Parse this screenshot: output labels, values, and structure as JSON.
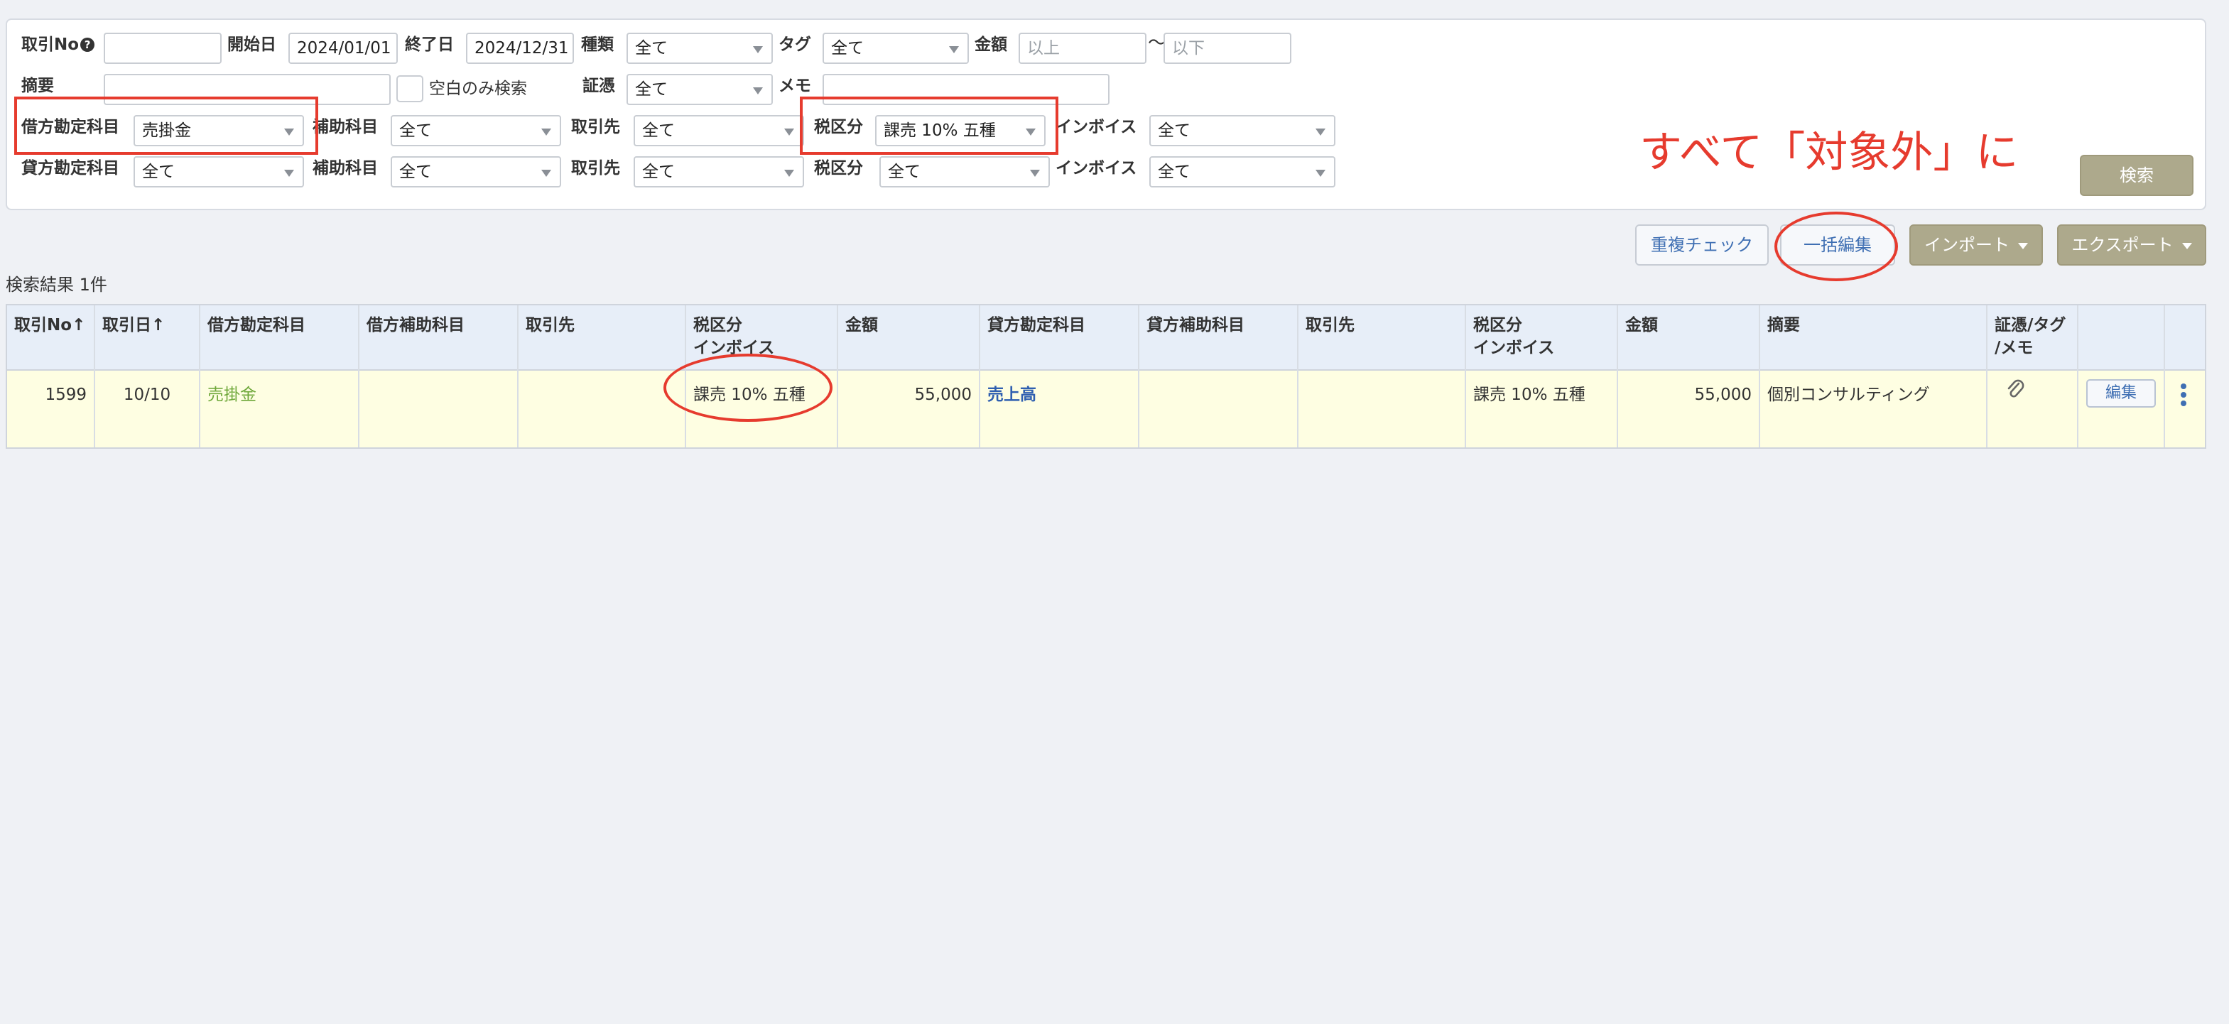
{
  "filters": {
    "row1": {
      "txn_no_label": "取引No",
      "help_icon": "?",
      "start_label": "開始日",
      "start_value": "2024/01/01",
      "end_label": "終了日",
      "end_value": "2024/12/31",
      "type_label": "種類",
      "type_value": "全て",
      "tag_label": "タグ",
      "tag_value": "全て",
      "amount_label": "金額",
      "amount_min_placeholder": "以上",
      "tilde": "〜",
      "amount_max_placeholder": "以下"
    },
    "row2": {
      "summary_label": "摘要",
      "blank_only_label": "空白のみ検索",
      "evidence_label": "証憑",
      "evidence_value": "全て",
      "memo_label": "メモ"
    },
    "row3": {
      "debit_account_label": "借方勘定科目",
      "debit_account_value": "売掛金",
      "sub_account_label": "補助科目",
      "sub_account_value": "全て",
      "partner_label": "取引先",
      "partner_value": "全て",
      "tax_label": "税区分",
      "tax_value": "課売 10% 五種",
      "invoice_label": "インボイス",
      "invoice_value": "全て"
    },
    "row4": {
      "credit_account_label": "貸方勘定科目",
      "credit_account_value": "全て",
      "sub_account_label": "補助科目",
      "sub_account_value": "全て",
      "partner_label": "取引先",
      "partner_value": "全て",
      "tax_label": "税区分",
      "tax_value": "全て",
      "invoice_label": "インボイス",
      "invoice_value": "全て"
    },
    "search_button": "検索"
  },
  "annotation": {
    "note": "すべて「対象外」に",
    "color": "#e63b2e"
  },
  "toolbar": {
    "duplicate_check": "重複チェック",
    "bulk_edit": "一括編集",
    "import": "インポート",
    "export": "エクスポート"
  },
  "results": {
    "count_text": "検索結果 1件",
    "headers": {
      "txn_no": "取引No",
      "txn_date": "取引日",
      "debit_account": "借方勘定科目",
      "debit_sub": "借方補助科目",
      "debit_partner": "取引先",
      "debit_tax_l1": "税区分",
      "debit_tax_l2": "インボイス",
      "debit_amount": "金額",
      "credit_account": "貸方勘定科目",
      "credit_sub": "貸方補助科目",
      "credit_partner": "取引先",
      "credit_tax_l1": "税区分",
      "credit_tax_l2": "インボイス",
      "credit_amount": "金額",
      "summary": "摘要",
      "evidence_l1": "証憑/タグ",
      "evidence_l2": "/メモ",
      "sort_icon": "↑"
    },
    "rows": [
      {
        "txn_no": "1599",
        "txn_date": "10/10",
        "debit_account": "売掛金",
        "debit_sub": "",
        "debit_partner": "",
        "debit_tax": "課売 10% 五種",
        "debit_amount": "55,000",
        "credit_account": "売上高",
        "credit_sub": "",
        "credit_partner": "",
        "credit_tax": "課売 10% 五種",
        "credit_amount": "55,000",
        "summary": "個別コンサルティング",
        "edit_label": "編集"
      }
    ]
  }
}
